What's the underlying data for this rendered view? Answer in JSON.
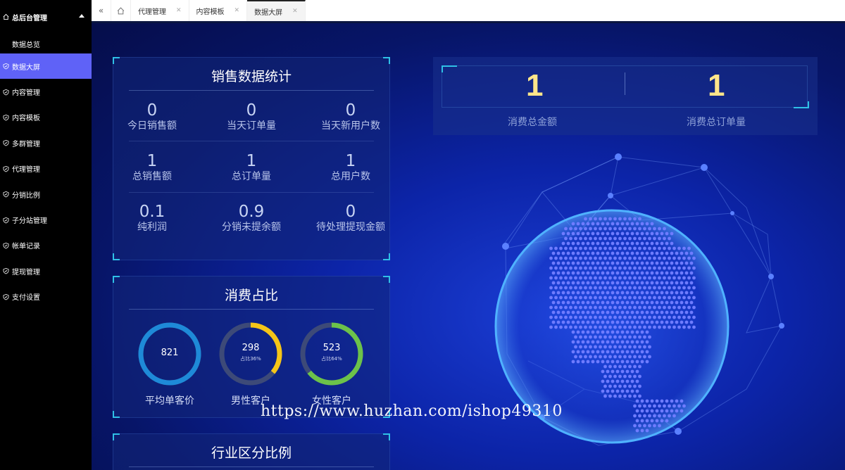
{
  "sidebar": {
    "header": "总后台管理",
    "sub_item": "数据总览",
    "items": [
      {
        "label": "数据大屏",
        "active": true
      },
      {
        "label": "内容管理"
      },
      {
        "label": "内容模板"
      },
      {
        "label": "多群管理"
      },
      {
        "label": "代理管理"
      },
      {
        "label": "分销比例"
      },
      {
        "label": "子分站管理"
      },
      {
        "label": "帐单记录"
      },
      {
        "label": "提现管理"
      },
      {
        "label": "支付设置"
      }
    ]
  },
  "tabs": [
    {
      "label": "代理管理"
    },
    {
      "label": "内容模板"
    },
    {
      "label": "数据大屏",
      "active": true
    }
  ],
  "sales_panel": {
    "title": "销售数据统计",
    "stats": [
      {
        "value": "0",
        "label": "今日销售额"
      },
      {
        "value": "0",
        "label": "当天订单量"
      },
      {
        "value": "0",
        "label": "当天新用户数"
      },
      {
        "value": "1",
        "label": "总销售额"
      },
      {
        "value": "1",
        "label": "总订单量"
      },
      {
        "value": "1",
        "label": "总用户数"
      },
      {
        "value": "0.1",
        "label": "纯利润"
      },
      {
        "value": "0.9",
        "label": "分销未提余额"
      },
      {
        "value": "0",
        "label": "待处理提现金额"
      }
    ]
  },
  "consume_panel": {
    "title": "消费占比",
    "rings": [
      {
        "value": "821",
        "sub": "",
        "label": "平均单客价",
        "fraction": 1.0,
        "color": "#1e8ad8"
      },
      {
        "value": "298",
        "sub": "占比36%",
        "label": "男性客户",
        "fraction": 0.36,
        "color": "#f5c518"
      },
      {
        "value": "523",
        "sub": "占比64%",
        "label": "女性客户",
        "fraction": 0.64,
        "color": "#6cc24a"
      }
    ]
  },
  "industry_panel": {
    "title": "行业区分比例"
  },
  "kpi": {
    "total_amount": {
      "value": "1",
      "label": "消费总金额"
    },
    "total_orders": {
      "value": "1",
      "label": "消费总订单量"
    }
  },
  "watermark": "https://www.huzhan.com/ishop49310",
  "colors": {
    "accent": "#5f62f7",
    "corner": "#2fc0e6",
    "kpi": "#ffe58a"
  }
}
